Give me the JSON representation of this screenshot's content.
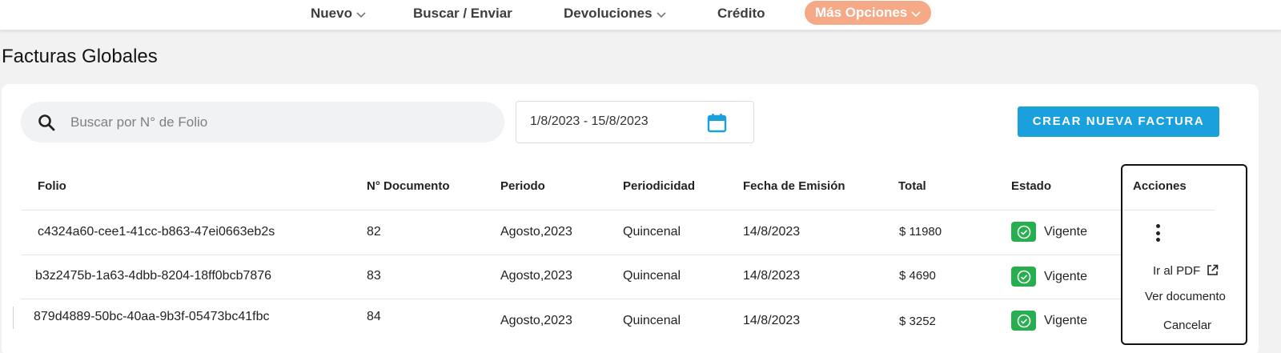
{
  "nav": {
    "items": [
      {
        "label": "Nuevo",
        "has_dropdown": true
      },
      {
        "label": "Buscar / Enviar",
        "has_dropdown": false
      },
      {
        "label": "Devoluciones",
        "has_dropdown": true
      },
      {
        "label": "Crédito",
        "has_dropdown": false
      },
      {
        "label": "Más Opciones",
        "has_dropdown": true,
        "highlight": true
      }
    ]
  },
  "page": {
    "title": "Facturas Globales"
  },
  "search": {
    "placeholder": "Buscar por N° de Folio",
    "value": ""
  },
  "date_range": {
    "value": "1/8/2023 - 15/8/2023"
  },
  "create_button": {
    "label": "CREAR NUEVA FACTURA"
  },
  "table": {
    "columns": [
      "Folio",
      "N° Documento",
      "Periodo",
      "Periodicidad",
      "Fecha de Emisión",
      "Total",
      "Estado",
      "Acciones"
    ],
    "rows": [
      {
        "folio": "c4324a60-cee1-41cc-b863-47ei0663eb2s",
        "documento": "82",
        "periodo": "Agosto,2023",
        "periodicidad": "Quincenal",
        "fecha": "14/8/2023",
        "total": "$ 11980",
        "estado": "Vigente"
      },
      {
        "folio": "b3z2475b-1a63-4dbb-8204-18ff0bcb7876",
        "documento": "83",
        "periodo": "Agosto,2023",
        "periodicidad": "Quincenal",
        "fecha": "14/8/2023",
        "total": "$ 4690",
        "estado": "Vigente"
      },
      {
        "folio": "879d4889-50bc-40aa-9b3f-05473bc41fbc",
        "documento": "84",
        "periodo": "Agosto,2023",
        "periodicidad": "Quincenal",
        "fecha": "14/8/2023",
        "total": "$ 3252",
        "estado": "Vigente"
      }
    ]
  },
  "actions_menu": {
    "items": [
      "Ir al PDF",
      "Ver documento",
      "Cancelar"
    ]
  },
  "colors": {
    "accent_button": "#1aa0dc",
    "nav_pill": "#f6a986",
    "status_green": "#27ae4f"
  },
  "icons": [
    "search-icon",
    "calendar-icon",
    "check-circle-icon",
    "kebab-menu-icon",
    "external-link-icon",
    "chevron-down-icon"
  ]
}
